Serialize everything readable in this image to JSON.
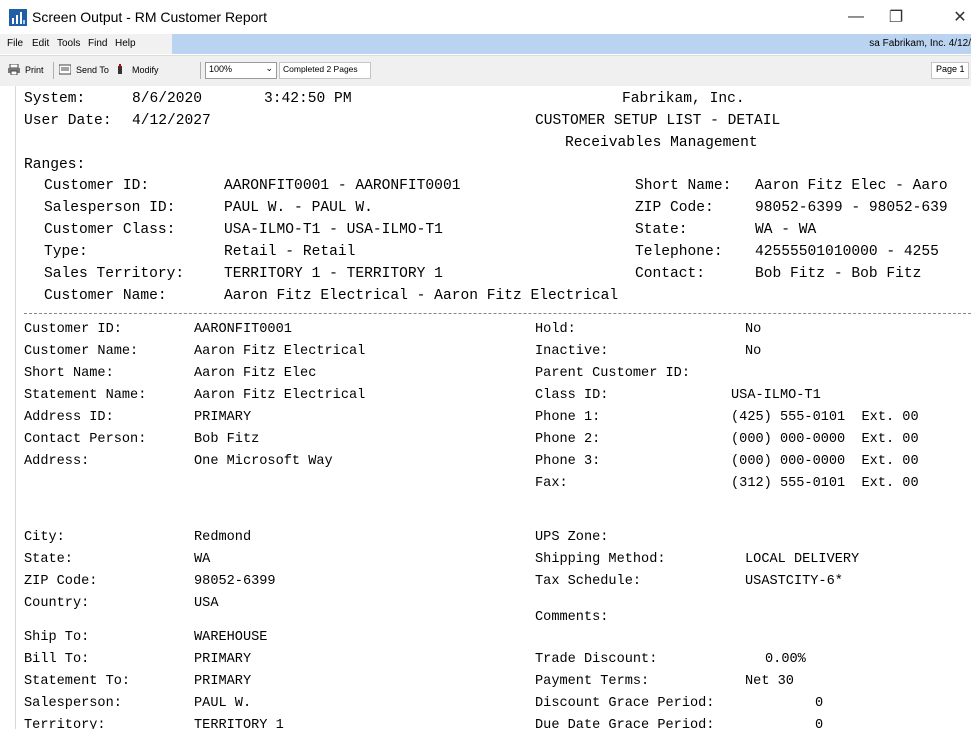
{
  "window": {
    "title": "Screen Output - RM Customer Report",
    "minimize": "—",
    "maximize": "❐",
    "close": "✕"
  },
  "menu": {
    "items": [
      "File",
      "Edit",
      "Tools",
      "Find",
      "Help"
    ],
    "company": "sa  Fabrikam, Inc. 4/12/"
  },
  "toolbar": {
    "print": "Print",
    "send_to": "Send To",
    "modify": "Modify",
    "zoom": "100%",
    "status": "Completed 2 Pages",
    "page": "Page 1"
  },
  "report": {
    "header": {
      "system_label": "System:",
      "system_date": "8/6/2020",
      "system_time": "3:42:50 PM",
      "user_date_label": "User Date:",
      "user_date": "4/12/2027",
      "company": "Fabrikam, Inc.",
      "report_title": "CUSTOMER SETUP LIST - DETAIL",
      "module": "Receivables Management"
    },
    "ranges_label": "Ranges:",
    "ranges_left": [
      {
        "label": "Customer ID:",
        "value": "AARONFIT0001 - AARONFIT0001"
      },
      {
        "label": "Salesperson ID:",
        "value": "PAUL W. - PAUL W."
      },
      {
        "label": "Customer Class:",
        "value": "USA-ILMO-T1 - USA-ILMO-T1"
      },
      {
        "label": "Type:",
        "value": "Retail - Retail"
      },
      {
        "label": "Sales Territory:",
        "value": "TERRITORY 1 - TERRITORY 1"
      },
      {
        "label": "Customer Name:",
        "value": "Aaron Fitz Electrical - Aaron Fitz Electrical"
      }
    ],
    "ranges_right": [
      {
        "label": "Short Name:",
        "value": "Aaron Fitz Elec - Aaro"
      },
      {
        "label": "ZIP Code:",
        "value": "98052-6399 - 98052-639"
      },
      {
        "label": "State:",
        "value": "WA - WA"
      },
      {
        "label": "Telephone:",
        "value": "42555501010000 - 4255"
      },
      {
        "label": "Contact:",
        "value": "Bob Fitz - Bob Fitz"
      }
    ],
    "detail_left": [
      {
        "label": "Customer ID:",
        "value": "AARONFIT0001"
      },
      {
        "label": "Customer Name:",
        "value": "Aaron Fitz Electrical"
      },
      {
        "label": "Short Name:",
        "value": "Aaron Fitz Elec"
      },
      {
        "label": "Statement Name:",
        "value": "Aaron Fitz Electrical"
      },
      {
        "label": "Address ID:",
        "value": "PRIMARY"
      },
      {
        "label": "Contact Person:",
        "value": "Bob Fitz"
      },
      {
        "label": "Address:",
        "value": "One Microsoft Way"
      }
    ],
    "detail_right": [
      {
        "label": "Hold:",
        "value": "No"
      },
      {
        "label": "Inactive:",
        "value": "No"
      },
      {
        "label": "Parent Customer ID:",
        "value": ""
      },
      {
        "label": "Class ID:",
        "value": "USA-ILMO-T1"
      },
      {
        "label": "Phone 1:",
        "value": "(425) 555-0101  Ext. 00"
      },
      {
        "label": "Phone 2:",
        "value": "(000) 000-0000  Ext. 00"
      },
      {
        "label": "Phone 3:",
        "value": "(000) 000-0000  Ext. 00"
      },
      {
        "label": "Fax:",
        "value": "(312) 555-0101  Ext. 00"
      }
    ],
    "location_left": [
      {
        "label": "City:",
        "value": "Redmond"
      },
      {
        "label": "State:",
        "value": "WA"
      },
      {
        "label": "ZIP Code:",
        "value": "98052-6399"
      },
      {
        "label": "Country:",
        "value": "USA"
      }
    ],
    "location_right": [
      {
        "label": "UPS Zone:",
        "value": ""
      },
      {
        "label": "Shipping Method:",
        "value": "LOCAL DELIVERY"
      },
      {
        "label": "Tax Schedule:",
        "value": "USASTCITY-6*"
      }
    ],
    "comments_label": "Comments:",
    "addresses_left": [
      {
        "label": "Ship To:",
        "value": "WAREHOUSE"
      },
      {
        "label": "Bill To:",
        "value": "PRIMARY"
      },
      {
        "label": "Statement To:",
        "value": "PRIMARY"
      },
      {
        "label": "Salesperson:",
        "value": "PAUL W."
      },
      {
        "label": "Territory:",
        "value": "TERRITORY 1"
      }
    ],
    "terms_right": [
      {
        "label": "Trade Discount:",
        "value": "0.00%"
      },
      {
        "label": "Payment Terms:",
        "value": "Net 30"
      },
      {
        "label": "Discount Grace Period:",
        "value": "0"
      },
      {
        "label": "Due Date Grace Period:",
        "value": "0"
      }
    ]
  }
}
